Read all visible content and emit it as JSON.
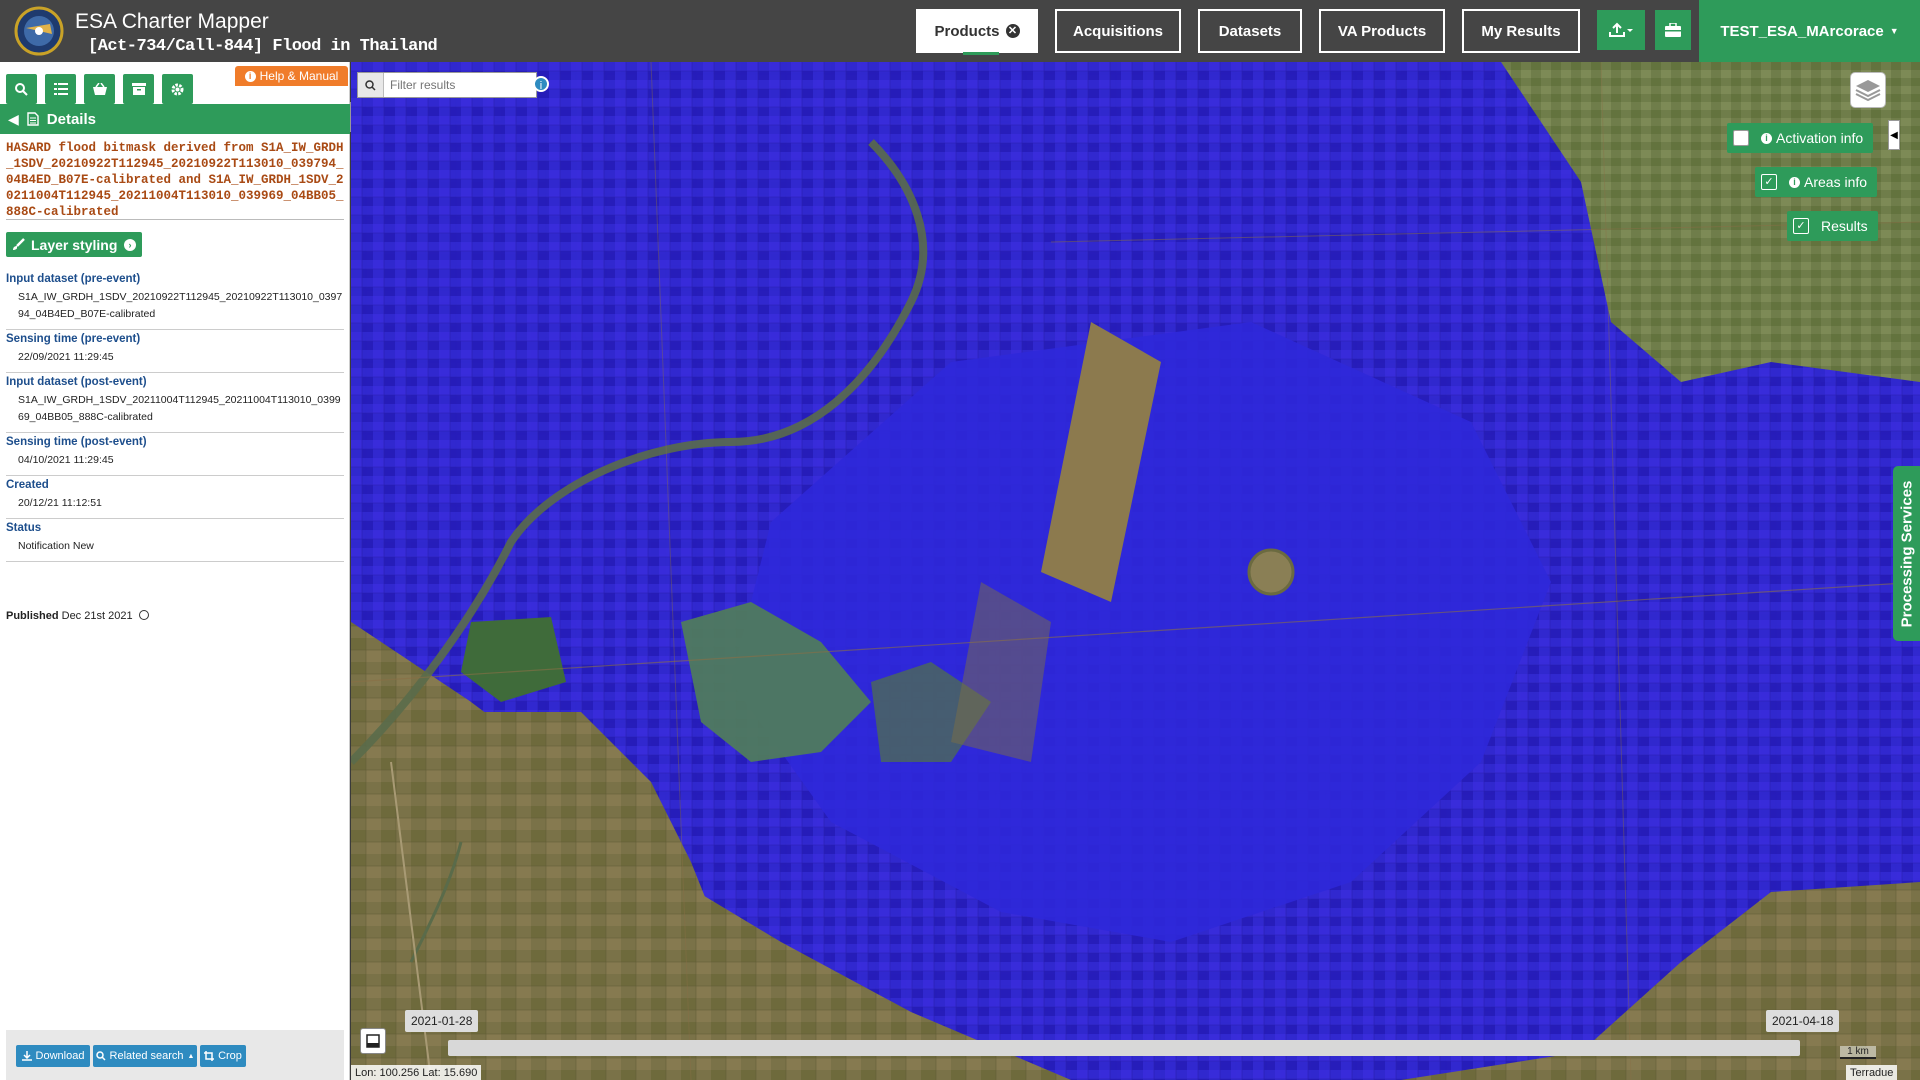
{
  "app": {
    "title": "ESA Charter Mapper",
    "subtitle": "[Act-734/Call-844] Flood in Thailand"
  },
  "nav": {
    "products": "Products",
    "acquisitions": "Acquisitions",
    "datasets": "Datasets",
    "va_products": "VA Products",
    "my_results": "My Results",
    "user": "TEST_ESA_MArcorace"
  },
  "sidebar": {
    "help_label": "Help & Manual",
    "details_label": "Details",
    "product_title": "HASARD flood bitmask derived from S1A_IW_GRDH_1SDV_20210922T112945_20210922T113010_039794_04B4ED_B07E-calibrated and S1A_IW_GRDH_1SDV_20211004T112945_20211004T113010_039969_04BB05_888C-calibrated",
    "layer_styling_label": "Layer styling",
    "fields": [
      {
        "label": "Input dataset (pre-event)",
        "value": "S1A_IW_GRDH_1SDV_20210922T112945_20210922T113010_039794_04B4ED_B07E-calibrated"
      },
      {
        "label": "Sensing time (pre-event)",
        "value": "22/09/2021 11:29:45"
      },
      {
        "label": "Input dataset (post-event)",
        "value": "S1A_IW_GRDH_1SDV_20211004T112945_20211004T113010_039969_04BB05_888C-calibrated"
      },
      {
        "label": "Sensing time (post-event)",
        "value": "04/10/2021 11:29:45"
      },
      {
        "label": "Created",
        "value": "20/12/21 11:12:51"
      },
      {
        "label": "Status",
        "value": "Notification New"
      }
    ],
    "published_label": "Published",
    "published_date": "Dec 21st 2021",
    "footer": {
      "download": "Download",
      "related_search": "Related search",
      "crop": "Crop"
    }
  },
  "map": {
    "search_placeholder": "Filter results",
    "overlays": {
      "activation_info": "Activation info",
      "areas_info": "Areas info",
      "results": "Results"
    },
    "processing_services": "Processing Services",
    "timeline_start": "2021-01-28",
    "timeline_end": "2021-04-18",
    "coordinates": "Lon: 100.256 Lat: 15.690",
    "scale": "1 km",
    "attribution": "Terradue"
  },
  "colors": {
    "accent_green": "#2e9b5a",
    "header_bg": "#454545",
    "help_orange": "#f07c2a",
    "flood_blue": "#2b1ee0",
    "link_blue": "#2e8bc0"
  },
  "icons": [
    "search-icon",
    "list-icon",
    "basket-icon",
    "archive-icon",
    "gear-icon",
    "info-icon",
    "document-icon",
    "brush-icon",
    "layers-icon",
    "upload-icon",
    "briefcase-icon",
    "download-icon",
    "crop-icon",
    "clock-icon"
  ]
}
